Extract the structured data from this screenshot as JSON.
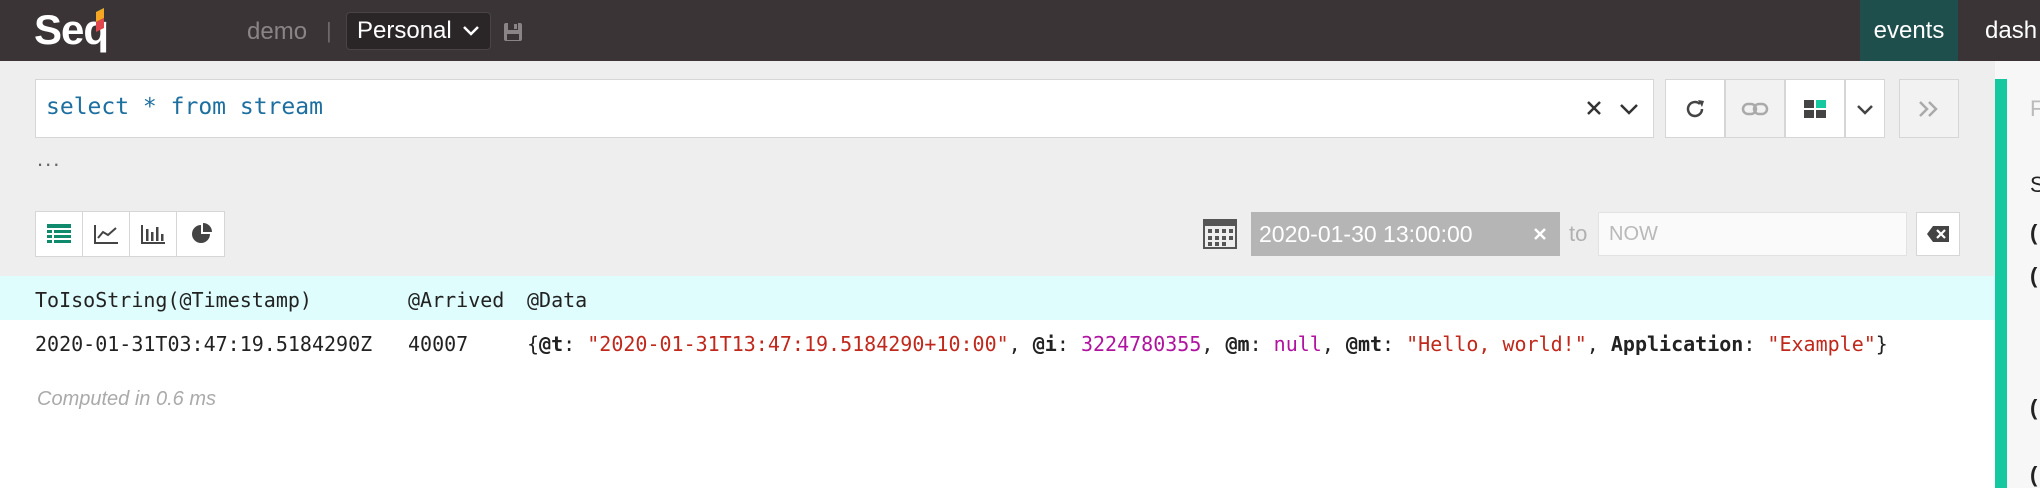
{
  "app": {
    "logo_text": "Seq",
    "instance_name": "demo",
    "separator": "|",
    "workspace": "Personal"
  },
  "nav": {
    "events_label": "events",
    "dash_label": "dash"
  },
  "query": {
    "text": "select * from stream",
    "ellipsis": "..."
  },
  "range": {
    "from_value": "2020-01-30 13:00:00",
    "to_label": "to",
    "to_placeholder": "NOW"
  },
  "results": {
    "columns": [
      "ToIsoString(@Timestamp)",
      "@Arrived",
      "@Data"
    ],
    "row": {
      "timestamp": "2020-01-31T03:47:19.5184290Z",
      "arrived": "40007",
      "data": {
        "open": "{",
        "t_key": "@t",
        "t_val": "\"2020-01-31T13:47:19.5184290+10:00\"",
        "i_key": "@i",
        "i_val": "3224780355",
        "m_key": "@m",
        "m_val": "null",
        "mt_key": "@mt",
        "mt_val": "\"Hello, world!\"",
        "app_key": "Application",
        "app_val": "\"Example\"",
        "close": "}"
      }
    },
    "computed": "Computed in 0.6 ms"
  },
  "side_panel": {
    "letters": [
      "F",
      "S",
      "(",
      "(",
      "(",
      "("
    ]
  },
  "colors": {
    "topbar": "#3a3436",
    "events_tab": "#1f4f4c",
    "accent": "#16c8a0",
    "header_row": "#e0fdfd",
    "string": "#c0281b",
    "number": "#b0139f",
    "query_keyword": "#1d6fa0"
  },
  "icons": {
    "save": "save-icon",
    "clear": "close-icon",
    "dropdown": "chevron-down-icon",
    "refresh": "refresh-icon",
    "link": "link-icon",
    "layout": "layout-icon",
    "expand": "double-chevron-right-icon",
    "table": "table-icon",
    "line": "line-chart-icon",
    "bar": "bar-chart-icon",
    "pie": "pie-chart-icon",
    "calendar": "calendar-icon",
    "backspace": "backspace-icon"
  }
}
